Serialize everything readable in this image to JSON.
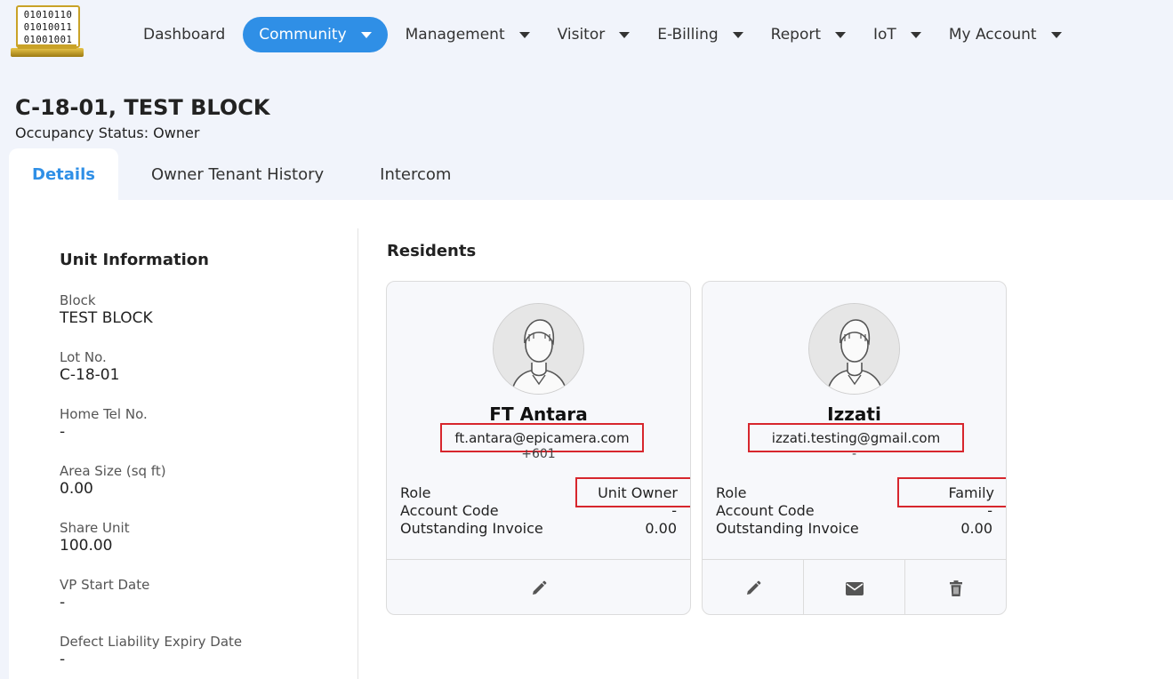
{
  "logo": {
    "lines": [
      "01010110",
      "01010011",
      "01001001"
    ]
  },
  "nav": {
    "items": [
      {
        "label": "Dashboard",
        "has_dropdown": false,
        "active": false
      },
      {
        "label": "Community",
        "has_dropdown": true,
        "active": true
      },
      {
        "label": "Management",
        "has_dropdown": true,
        "active": false
      },
      {
        "label": "Visitor",
        "has_dropdown": true,
        "active": false
      },
      {
        "label": "E-Billing",
        "has_dropdown": true,
        "active": false
      },
      {
        "label": "Report",
        "has_dropdown": true,
        "active": false
      },
      {
        "label": "IoT",
        "has_dropdown": true,
        "active": false
      },
      {
        "label": "My Account",
        "has_dropdown": true,
        "active": false
      }
    ]
  },
  "header": {
    "title": "C-18-01, TEST BLOCK",
    "occupancy_label": "Occupancy Status:",
    "occupancy_value": "Owner"
  },
  "tabs": [
    {
      "label": "Details",
      "active": true
    },
    {
      "label": "Owner Tenant History",
      "active": false
    },
    {
      "label": "Intercom",
      "active": false
    }
  ],
  "unit_info": {
    "title": "Unit Information",
    "fields": [
      {
        "label": "Block",
        "value": "TEST BLOCK"
      },
      {
        "label": "Lot No.",
        "value": "C-18-01"
      },
      {
        "label": "Home Tel No.",
        "value": "-"
      },
      {
        "label": "Area Size (sq ft)",
        "value": "0.00"
      },
      {
        "label": "Share Unit",
        "value": "100.00"
      },
      {
        "label": "VP Start Date",
        "value": "-"
      },
      {
        "label": "Defect Liability Expiry Date",
        "value": "-"
      }
    ]
  },
  "residents": {
    "title": "Residents",
    "cards": [
      {
        "name": "FT Antara",
        "email": "ft.antara@epicamera.com",
        "phone": "+601",
        "role_label": "Role",
        "role_value": "Unit Owner",
        "account_code_label": "Account Code",
        "account_code_value": "-",
        "invoice_label": "Outstanding Invoice",
        "invoice_value": "0.00",
        "actions": [
          "edit-icon"
        ]
      },
      {
        "name": "Izzati",
        "email": "izzati.testing@gmail.com",
        "phone": "-",
        "role_label": "Role",
        "role_value": "Family",
        "account_code_label": "Account Code",
        "account_code_value": "-",
        "invoice_label": "Outstanding Invoice",
        "invoice_value": "0.00",
        "actions": [
          "edit-icon",
          "envelope-icon",
          "trash-icon"
        ]
      }
    ]
  },
  "colors": {
    "accent": "#2f8fe6",
    "highlight": "#d7262d",
    "background": "#f1f4fb"
  }
}
